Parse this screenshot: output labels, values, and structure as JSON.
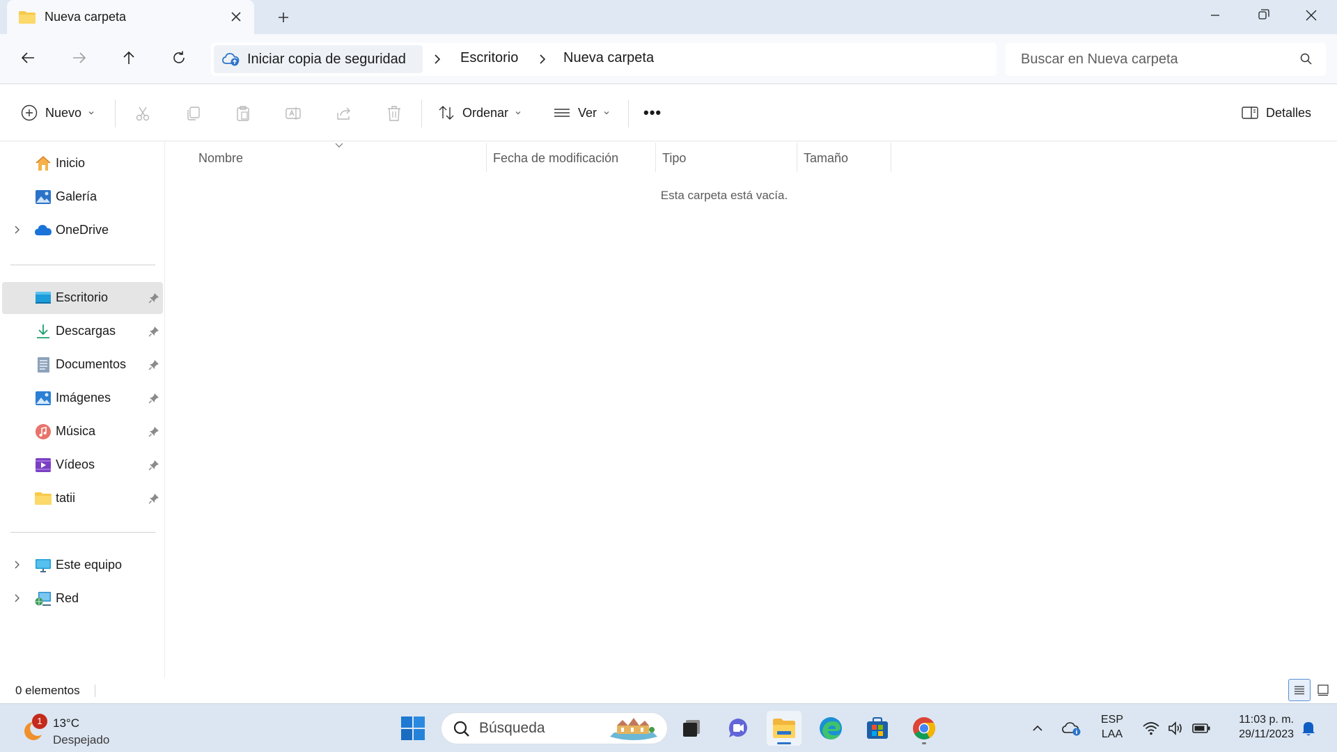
{
  "window": {
    "tab_title": "Nueva carpeta",
    "new_tab_symbol": "+"
  },
  "address": {
    "backup_label": "Iniciar copia de seguridad",
    "breadcrumbs": [
      "Escritorio",
      "Nueva carpeta"
    ],
    "search_placeholder": "Buscar en Nueva carpeta"
  },
  "toolbar": {
    "new_label": "Nuevo",
    "sort_label": "Ordenar",
    "view_label": "Ver",
    "more_label": "•••",
    "details_label": "Detalles"
  },
  "sidebar": {
    "items": [
      {
        "label": "Inicio",
        "icon": "home-icon"
      },
      {
        "label": "Galería",
        "icon": "gallery-icon"
      },
      {
        "label": "OneDrive",
        "icon": "cloud-icon"
      },
      {
        "label": "Escritorio",
        "icon": "desktop-icon"
      },
      {
        "label": "Descargas",
        "icon": "download-icon"
      },
      {
        "label": "Documentos",
        "icon": "document-icon"
      },
      {
        "label": "Imágenes",
        "icon": "pictures-icon"
      },
      {
        "label": "Música",
        "icon": "music-icon"
      },
      {
        "label": "Vídeos",
        "icon": "video-icon"
      },
      {
        "label": "tatii",
        "icon": "folder-icon"
      },
      {
        "label": "Este equipo",
        "icon": "computer-icon"
      },
      {
        "label": "Red",
        "icon": "network-icon"
      }
    ]
  },
  "content": {
    "columns": [
      "Nombre",
      "Fecha de modificación",
      "Tipo",
      "Tamaño"
    ],
    "empty_message": "Esta carpeta está vacía."
  },
  "status": {
    "item_count": "0 elementos"
  },
  "taskbar": {
    "weather_badge": "1",
    "weather_temp": "13°C",
    "weather_condition": "Despejado",
    "search_placeholder": "Búsqueda",
    "lang_line1": "ESP",
    "lang_line2": "LAA",
    "time": "11:03 p. m.",
    "date": "29/11/2023"
  },
  "colors": {
    "titlebar": "#dfe8f3",
    "accent": "#2b73c9",
    "selected_nav": "#e5e5e5",
    "folder": "#f8c94a"
  }
}
